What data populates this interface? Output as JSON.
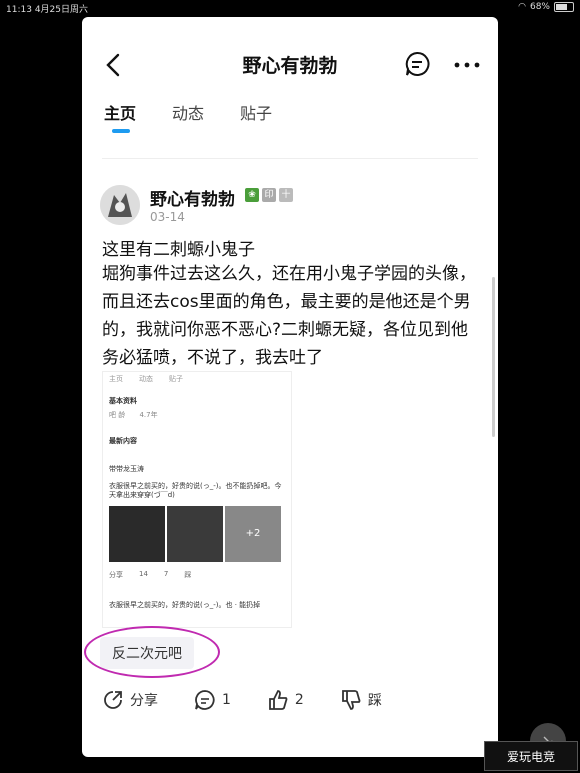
{
  "status_bar": {
    "time": "11:13",
    "date": "4月25日周六",
    "battery": "68%",
    "battery_level": 0.68
  },
  "header": {
    "title": "野心有勃勃"
  },
  "tabs": [
    {
      "label": "主页"
    },
    {
      "label": "动态"
    },
    {
      "label": "贴子"
    }
  ],
  "post": {
    "author": "野心有勃勃",
    "badge_1": "印",
    "badge_2": "十",
    "date": "03-14",
    "title": "这里有二刺螈小鬼子",
    "body": "堀狗事件过去这么久，还在用小鬼子学园的头像，而且还去cos里面的角色，最主要的是他还是个男的，我就问你恶不恶心?二刺螈无疑，各位见到他务必猛喷，不说了，我去吐了",
    "embedded_screenshot": {
      "tabs": [
        "主页",
        "动态",
        "贴子"
      ],
      "section1": "基本资料",
      "field_label": "吧 龄",
      "field_value": "4.7年",
      "section2": "最新内容",
      "author": "带带龙玉涛",
      "text1": "衣服很早之前买的，好贵的说(っ_-)。也不能扔掉吧。今天拿出来穿穿(づ￣d)",
      "more_count": "+2",
      "share": "分享",
      "comment_count": "14",
      "like_count": "7",
      "dislike": "踩",
      "text2": "衣服很早之前买的，好贵的说(っ_-)。也 · 能扔掉"
    },
    "topic": "反二次元吧",
    "actions": {
      "share": "分享",
      "comments": "1",
      "likes": "2",
      "dislike": "踩"
    }
  },
  "watermark": "爱玩电竞"
}
